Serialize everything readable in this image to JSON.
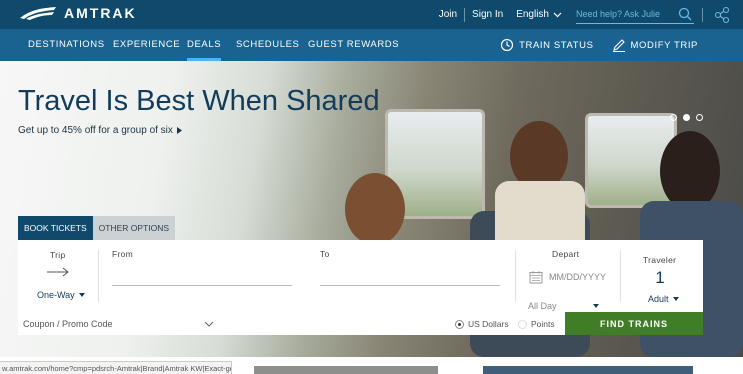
{
  "brand": {
    "name": "AMTRAK"
  },
  "topbar": {
    "join": "Join",
    "sign_in": "Sign In",
    "language": "English",
    "search_placeholder": "Need help? Ask Julie"
  },
  "nav": {
    "items": [
      "DESTINATIONS",
      "EXPERIENCE",
      "DEALS",
      "SCHEDULES",
      "GUEST REWARDS"
    ],
    "active_index": 2,
    "train_status": "TRAIN STATUS",
    "modify_trip": "MODIFY TRIP"
  },
  "hero": {
    "headline": "Travel Is Best When Shared",
    "subline": "Get up to 45% off for a group of six",
    "carousel_active": 1
  },
  "booking": {
    "tabs": [
      "BOOK TICKETS",
      "OTHER OPTIONS"
    ],
    "trip_label": "Trip",
    "trip_value": "One-Way",
    "from_label": "From",
    "to_label": "To",
    "depart_label": "Depart",
    "date_placeholder": "MM/DD/YYYY",
    "time_value": "All Day",
    "traveler_label": "Traveler",
    "traveler_count": "1",
    "traveler_type": "Adult",
    "coupon_label": "Coupon / Promo Code",
    "currency_us": "US Dollars",
    "currency_points": "Points",
    "find_button": "FIND TRAINS"
  },
  "status_bar": {
    "url": "w.amtrak.com/home?cmp=pdsrch-Amtrak|Brand|Amtrak KW|Exact-google&gclid..."
  },
  "colors": {
    "top_bar": "#0f4a6c",
    "nav_bar": "#1a6390",
    "accent": "#4fb3ef",
    "find_button": "#3f7e27",
    "headline": "#123c5a"
  }
}
